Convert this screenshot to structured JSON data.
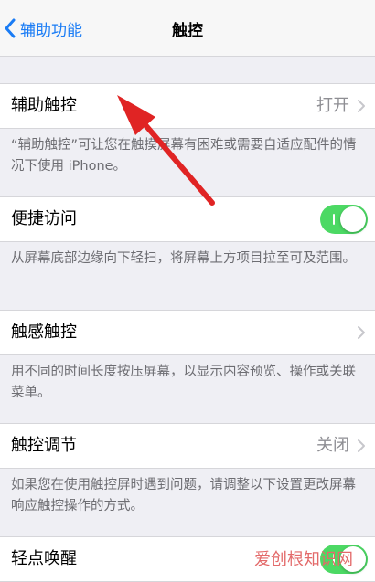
{
  "navbar": {
    "back_label": "辅助功能",
    "title": "触控"
  },
  "rows": [
    {
      "label": "辅助触控",
      "value": "打开"
    },
    {
      "label": "便捷访问"
    },
    {
      "label": "触感触控"
    },
    {
      "label": "触控调节",
      "value": "关闭"
    },
    {
      "label": "轻点唤醒"
    }
  ],
  "footers": [
    "“辅助触控”可让您在触摸屏幕有困难或需要自适应配件的情况下使用 iPhone。",
    "从屏幕底部边缘向下轻扫，将屏幕上方项目拉至可及范围。",
    "用不同的时间长度按压屏幕，以显示内容预览、操作或关联菜单。",
    "如果您在使用触控屏时遇到问题，请调整以下设置更改屏幕响应触控操作的方式。"
  ],
  "toggles": {
    "convenient_access": "on",
    "tap_to_wake": "on"
  },
  "watermark": "爱创根知识网",
  "colors": {
    "accent": "#1a7cf5",
    "toggle_on": "#4cd964",
    "annotation_arrow": "#e02424"
  }
}
